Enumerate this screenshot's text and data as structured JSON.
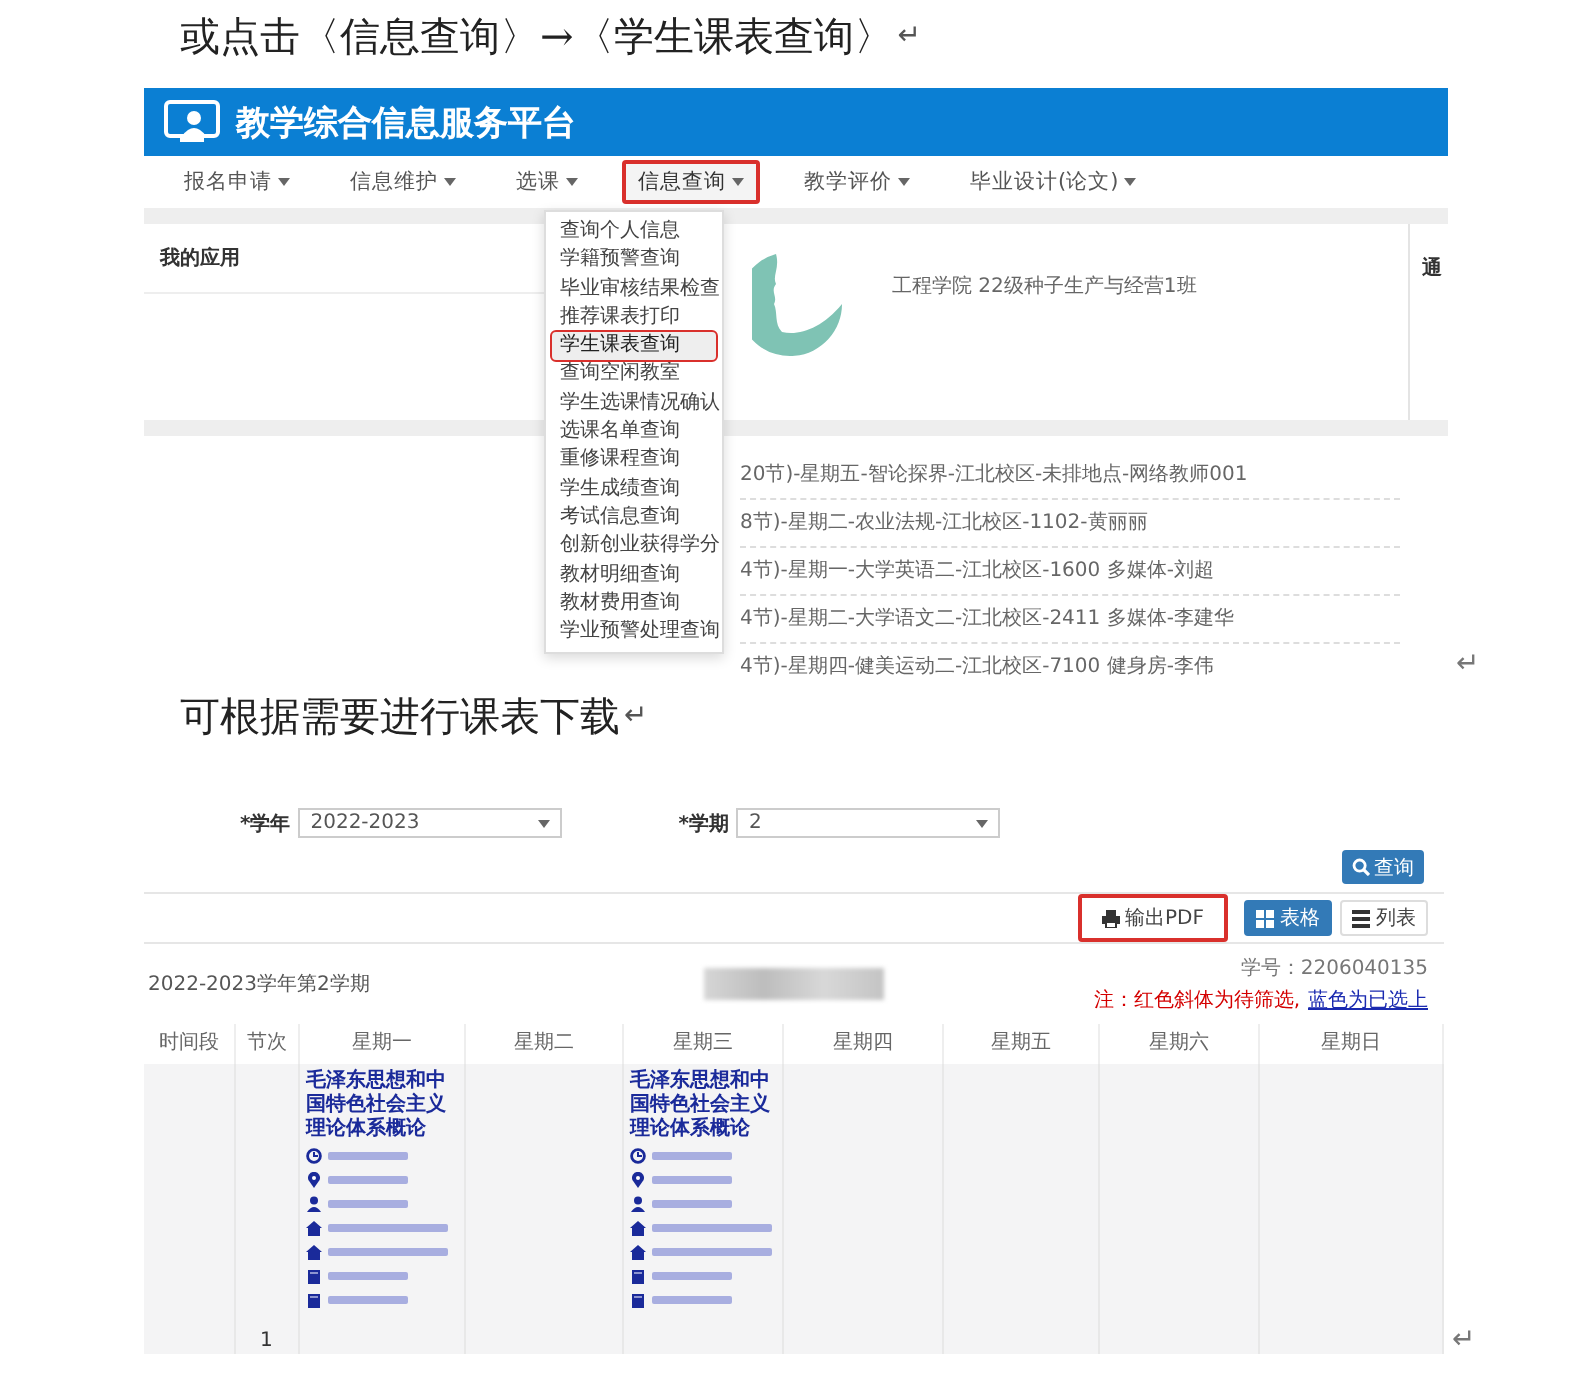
{
  "paragraphs": [
    {
      "kind": "text",
      "text": "或点击〈信息查询〉→〈学生课表查询〉",
      "mark": "↵"
    },
    {
      "kind": "portal",
      "mark": "↵",
      "portal": {
        "app_title": "教学综合信息服务平台",
        "nav": [
          {
            "label": "报名申请",
            "selected": false,
            "annotated": false
          },
          {
            "label": "信息维护",
            "selected": false,
            "annotated": false
          },
          {
            "label": "选课",
            "selected": false,
            "annotated": false
          },
          {
            "label": "信息查询",
            "selected": true,
            "annotated": true
          },
          {
            "label": "教学评价",
            "selected": false,
            "annotated": false
          },
          {
            "label": "毕业设计(论文)",
            "selected": false,
            "annotated": false
          }
        ],
        "menu": [
          {
            "label": "查询个人信息",
            "selected": false,
            "annotated": false
          },
          {
            "label": "学籍预警查询",
            "selected": false,
            "annotated": false
          },
          {
            "label": "毕业审核结果检查",
            "selected": false,
            "annotated": false
          },
          {
            "label": "推荐课表打印",
            "selected": false,
            "annotated": false
          },
          {
            "label": "学生课表查询",
            "selected": true,
            "annotated": true
          },
          {
            "label": "查询空闲教室",
            "selected": false,
            "annotated": false
          },
          {
            "label": "学生选课情况确认",
            "selected": false,
            "annotated": false
          },
          {
            "label": "选课名单查询",
            "selected": false,
            "annotated": false
          },
          {
            "label": "重修课程查询",
            "selected": false,
            "annotated": false
          },
          {
            "label": "学生成绩查询",
            "selected": false,
            "annotated": false
          },
          {
            "label": "考试信息查询",
            "selected": false,
            "annotated": false
          },
          {
            "label": "创新创业获得学分",
            "selected": false,
            "annotated": false
          },
          {
            "label": "教材明细查询",
            "selected": false,
            "annotated": false
          },
          {
            "label": "教材费用查询",
            "selected": false,
            "annotated": false
          },
          {
            "label": "学业预警处理查询",
            "selected": false,
            "annotated": false
          }
        ],
        "apps_heading": "我的应用",
        "profile_text": "工程学院 22级种子生产与经营1班",
        "side_heading": "通",
        "course_list": [
          "20节)-星期五-智论探界-江北校区-未排地点-网络教师001",
          "8节)-星期二-农业法规-江北校区-1102-黄丽丽",
          "4节)-星期一-大学英语二-江北校区-1600 多媒体-刘超",
          "4节)-星期二-大学语文二-江北校区-2411 多媒体-李建华",
          "4节)-星期四-健美运动二-江北校区-7100 健身房-李伟"
        ]
      }
    },
    {
      "kind": "text",
      "text": "可根据需要进行课表下载",
      "mark": "↵"
    },
    {
      "kind": "schedule",
      "mark": "↵",
      "schedule": {
        "filters": [
          {
            "label": "*学年",
            "value": "2022-2023"
          },
          {
            "label": "*学期",
            "value": "2"
          }
        ],
        "search_button": "查询",
        "view_buttons": [
          {
            "label": "输出PDF",
            "kind": "print",
            "selected": false,
            "annotated": true
          },
          {
            "label": "表格",
            "kind": "grid",
            "selected": true,
            "annotated": false
          },
          {
            "label": "列表",
            "kind": "list",
            "selected": false,
            "annotated": false
          }
        ],
        "term": "2022-2023学年第2学期",
        "student_id": "学号：2206040135",
        "note_pending": "注：红色斜体为待筛选,",
        "note_chosen": "蓝色为已选上",
        "columns": [
          {
            "label": "时间段"
          },
          {
            "label": "节次"
          },
          {
            "label": "星期一",
            "course": {
              "title": "毛泽东思想和中国特色社会主义理论体系概论",
              "details": [
                {
                  "kind": "clock"
                },
                {
                  "kind": "pin"
                },
                {
                  "kind": "person"
                },
                {
                  "kind": "house"
                },
                {
                  "kind": "house"
                },
                {
                  "kind": "book"
                },
                {
                  "kind": "book"
                }
              ]
            }
          },
          {
            "label": "星期二"
          },
          {
            "label": "星期三",
            "course": {
              "title": "毛泽东思想和中国特色社会主义理论体系概论",
              "details": [
                {
                  "kind": "clock"
                },
                {
                  "kind": "pin"
                },
                {
                  "kind": "person"
                },
                {
                  "kind": "house"
                },
                {
                  "kind": "house"
                },
                {
                  "kind": "book"
                },
                {
                  "kind": "book"
                }
              ]
            }
          },
          {
            "label": "星期四"
          },
          {
            "label": "星期五"
          },
          {
            "label": "星期六"
          },
          {
            "label": "星期日"
          }
        ],
        "period": "1"
      }
    }
  ]
}
